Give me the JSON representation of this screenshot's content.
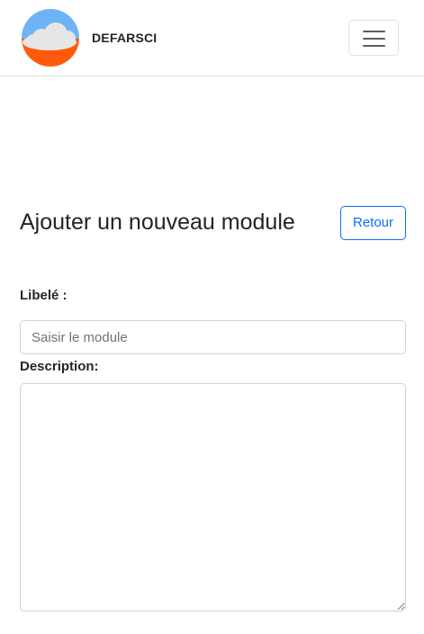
{
  "navbar": {
    "brand_name": "DEFARSCI",
    "logo_icon": "cloud-logo-icon",
    "toggler_icon": "hamburger-menu-icon"
  },
  "main": {
    "title": "Ajouter un nouveau module",
    "back_button_label": "Retour"
  },
  "form": {
    "libele_label": "Libelé :",
    "libele_placeholder": "Saisir le module",
    "libele_value": "",
    "description_label": "Description:",
    "description_value": ""
  },
  "colors": {
    "primary": "#0d6efd",
    "logo_sky": "#6cb4f5",
    "logo_ground": "#ff5a0a",
    "logo_cloud": "#e6e6e6",
    "border": "#ced4da"
  }
}
